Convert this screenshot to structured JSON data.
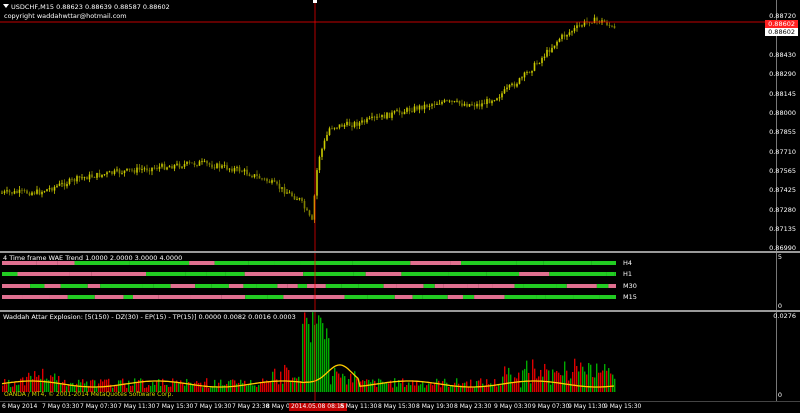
{
  "main": {
    "symbol_line": "USDCHF,M15  0.88623 0.88639 0.88587 0.88602",
    "copyright": "copyright waddahwttar@hotmail.com",
    "price_axis": [
      "0.88720",
      "0.88430",
      "0.88290",
      "0.88145",
      "0.88000",
      "0.87855",
      "0.87710",
      "0.87565",
      "0.87425",
      "0.87280",
      "0.87135",
      "0.86990"
    ],
    "current_price": "0.88602",
    "current_price_red": "0.88602",
    "candle_bull_color": "#cccc00",
    "candle_bear_color": "#808000",
    "crosshair_color": "#ff0000"
  },
  "trend": {
    "title": "4 Time frame WAE Trend 1.0000 2.0000 3.0000 4.0000",
    "axis": [
      "5",
      "0"
    ],
    "rows": [
      "H4",
      "H1",
      "M30",
      "M15"
    ],
    "up_color": "#22cc22",
    "down_color": "#e07090"
  },
  "explosion": {
    "title": "Waddah Attar Explosion: [5(150) - DZ(30) - EP(15) - TP(15)] 0.0000 0.0082 0.0016 0.0003",
    "axis": [
      "0.0276",
      "0"
    ],
    "watermark": "OANDA / MT4, © 2001-2014 MetaQuotes Software Corp.",
    "up_color": "#00aa00",
    "down_color": "#dd0000",
    "line_color": "#ffcc00"
  },
  "time_axis": [
    "6 May 2014",
    "7 May 03:30",
    "7 May 07:30",
    "7 May 11:30",
    "7 May 15:30",
    "7 May 19:30",
    "7 May 23:30",
    "8 May 03:30",
    "8 May 07:30",
    "8 May 11:30",
    "8 May 15:30",
    "8 May 19:30",
    "8 May 23:30",
    "9 May 03:30",
    "9 May 07:30",
    "9 May 11:30",
    "9 May 15:30"
  ],
  "time_axis_highlight": "2014.05.08 08:15"
}
